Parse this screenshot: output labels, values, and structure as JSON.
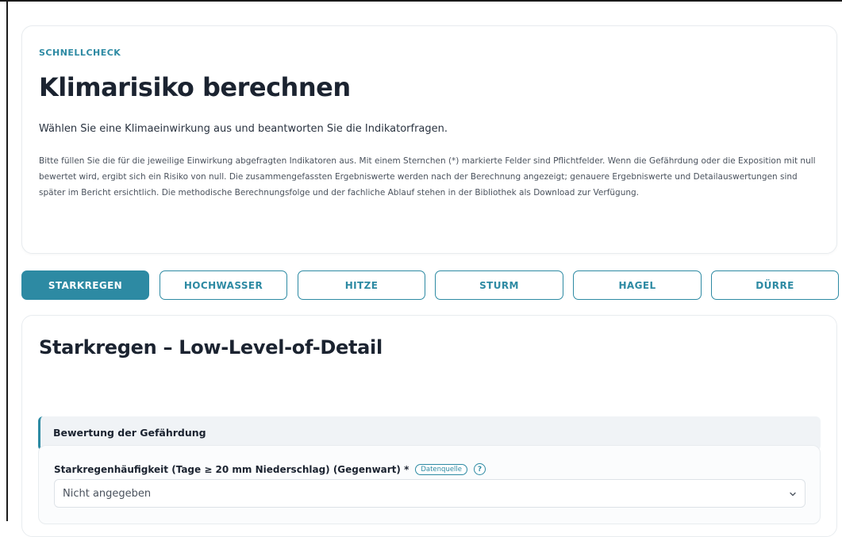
{
  "intro": {
    "eyebrow": "SCHNELLCHECK",
    "title": "Klimarisiko berechnen",
    "lead": "Wählen Sie eine Klimaeinwirkung aus und beantworten Sie die Indikatorfragen.",
    "description": "Bitte füllen Sie die für die jeweilige Einwirkung abgefragten Indikatoren aus. Mit einem Sternchen (*) markierte Felder sind Pflichtfelder. Wenn die Gefährdung oder die Exposition mit null bewertet wird, ergibt sich ein Risiko von null. Die zusammengefassten Ergebniswerte werden nach der Berechnung angezeigt; genauere Ergebniswerte und Detailauswertungen sind später im Bericht ersichtlich. Die methodische Berechnungsfolge und der fachliche Ablauf stehen in der Bibliothek als Download zur Verfügung."
  },
  "tabs": [
    {
      "label": "STARKREGEN",
      "active": true
    },
    {
      "label": "HOCHWASSER",
      "active": false
    },
    {
      "label": "HITZE",
      "active": false
    },
    {
      "label": "STURM",
      "active": false
    },
    {
      "label": "HAGEL",
      "active": false
    },
    {
      "label": "DÜRRE",
      "active": false
    }
  ],
  "main": {
    "title": "Starkregen – Low-Level-of-Detail",
    "subsection_title": "Bewertung der Gefährdung",
    "field": {
      "label": "Starkregenhäufigkeit (Tage ≥ 20 mm Niederschlag) (Gegenwart) *",
      "source_badge": "Datenquelle",
      "help": "?",
      "value": "Nicht angegeben"
    }
  },
  "colors": {
    "accent": "#2d8aa3",
    "text_dark": "#1b2330",
    "subsection_bg": "#f0f3f6"
  },
  "icons": {
    "help": "question-circle-icon",
    "select": "chevron-down-icon"
  }
}
